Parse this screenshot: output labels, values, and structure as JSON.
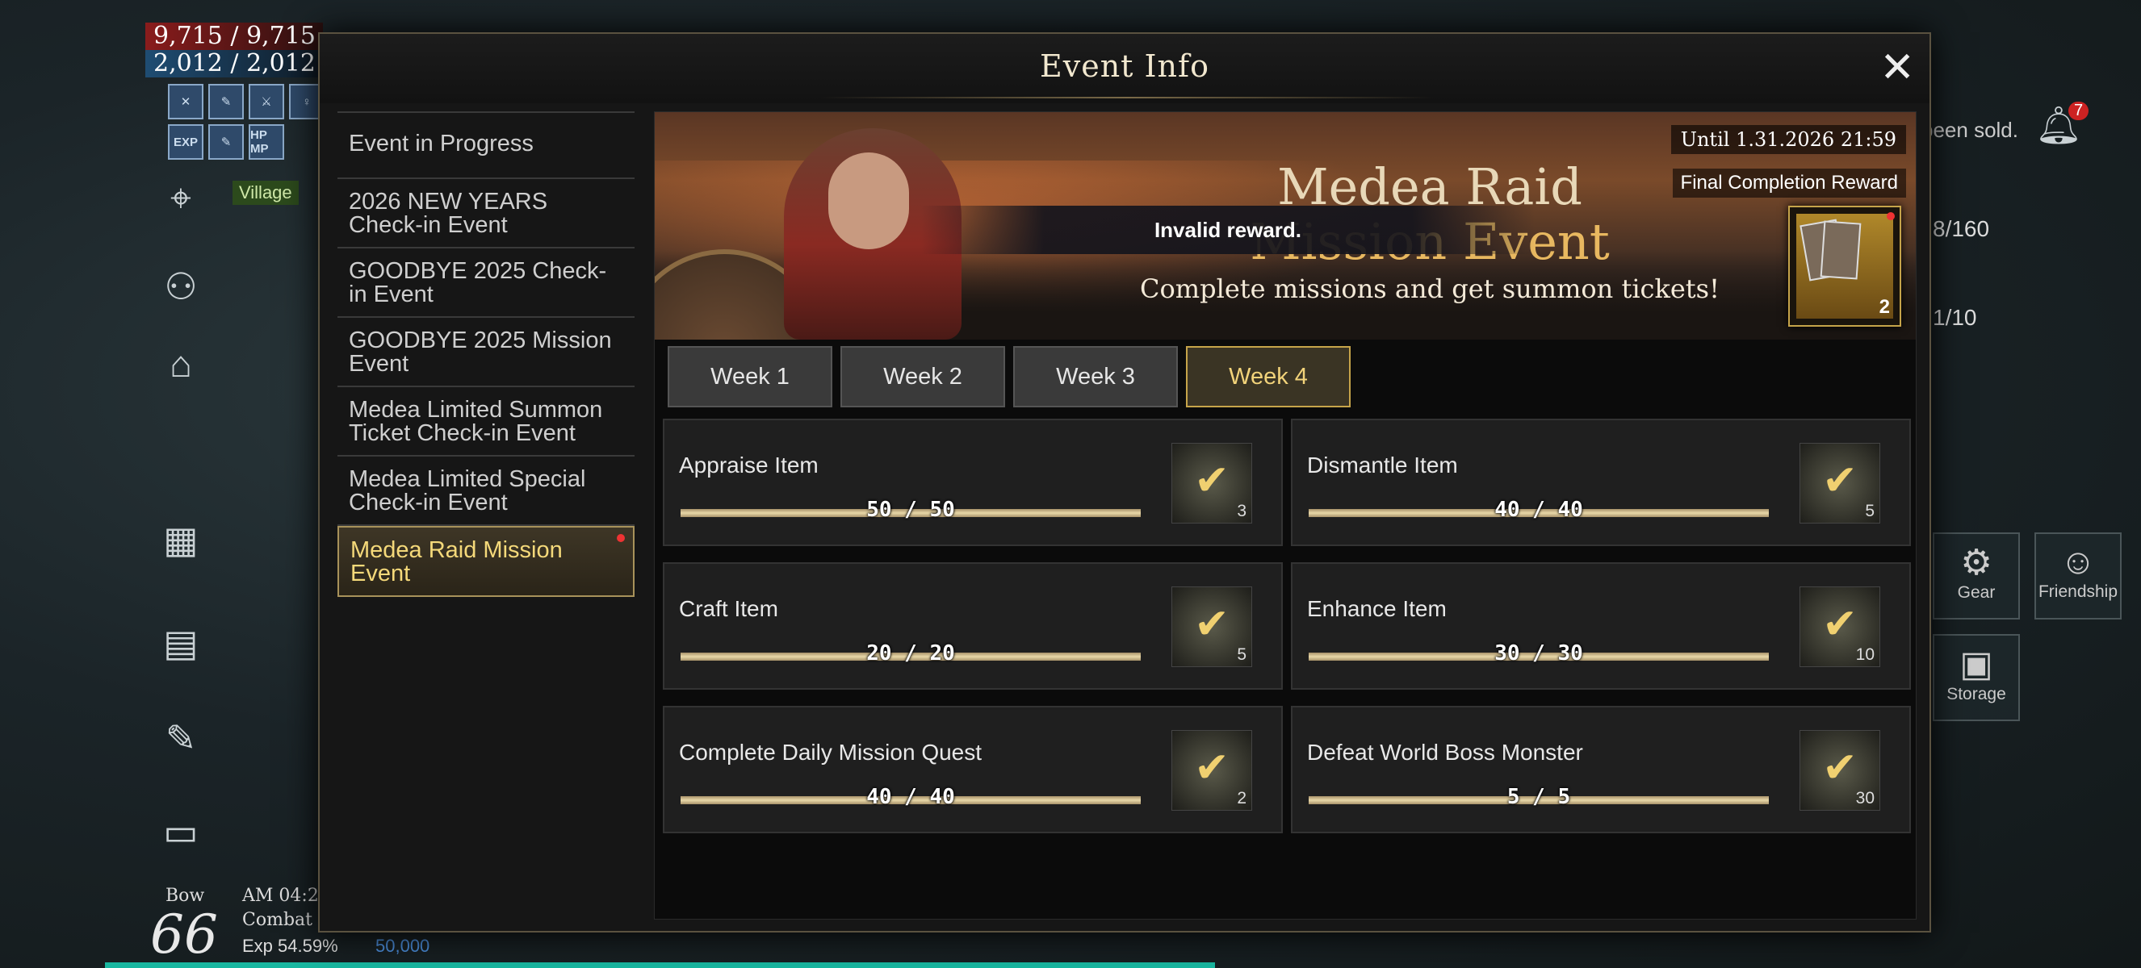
{
  "hud": {
    "hp": "9,715 / 9,715",
    "mp": "2,012 / 2,012",
    "village_tag": "Village",
    "buffs": [
      "✕",
      "✎",
      "⚔",
      "♀",
      "EXP",
      "✎",
      "HP MP"
    ],
    "class": "Bow",
    "level": "66",
    "time": "AM 04:2",
    "combat": "Combat",
    "exp": "Exp 54.59%",
    "gold": "50,000",
    "notice": "been sold.",
    "bell_count": "7",
    "counter_a": "8/160",
    "counter_b": "1/10",
    "side_gear": "Gear",
    "side_friendship": "Friendship",
    "side_storage": "Storage"
  },
  "modal": {
    "title": "Event Info",
    "close_glyph": "✕",
    "nav": [
      "Event in Progress",
      "2026 NEW YEARS Check-in Event",
      "GOODBYE 2025 Check-in Event",
      "GOODBYE 2025 Mission Event",
      "Medea Limited Summon Ticket Check-in Event",
      "Medea Limited Special Check-in Event",
      "Medea Raid Mission Event"
    ],
    "banner": {
      "until": "Until 1.31.2026 21:59",
      "final_reward_label": "Final Completion Reward",
      "reward_qty": "2",
      "title_line1": "Medea Raid",
      "title_line2": "Mission Event",
      "subtitle": "Complete missions and get summon tickets!"
    },
    "toast": "Invalid reward.",
    "tabs": [
      "Week 1",
      "Week 2",
      "Week 3",
      "Week 4"
    ],
    "active_tab": "Week 4",
    "missions": [
      {
        "name": "Appraise Item",
        "progress": "50 / 50",
        "reward": "3"
      },
      {
        "name": "Dismantle Item",
        "progress": "40 / 40",
        "reward": "5"
      },
      {
        "name": "Craft Item",
        "progress": "20 / 20",
        "reward": "5"
      },
      {
        "name": "Enhance Item",
        "progress": "30 / 30",
        "reward": "10"
      },
      {
        "name": "Complete Daily Mission Quest",
        "progress": "40 / 40",
        "reward": "2"
      },
      {
        "name": "Defeat World Boss Monster",
        "progress": "5 / 5",
        "reward": "30"
      }
    ]
  },
  "colors": {
    "accent_gold": "#c6a44a",
    "exp_bar": "#19b7a0",
    "gold_text": "#4a8bd6"
  }
}
